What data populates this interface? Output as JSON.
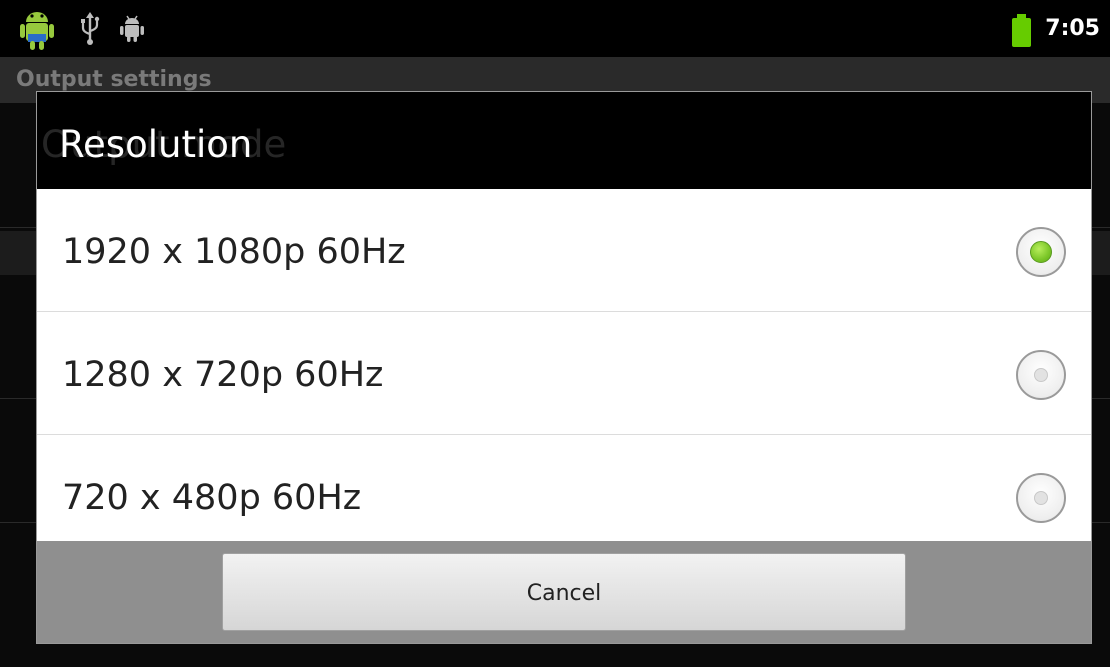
{
  "status_bar": {
    "time": "7:05",
    "left_icons": [
      "android-icon",
      "usb-icon",
      "debug-icon"
    ],
    "battery_color": "#66cc00"
  },
  "background_app": {
    "title": "Output settings",
    "obscured_item": "Output mode"
  },
  "dialog": {
    "title": "Resolution",
    "options": [
      {
        "label": "1920 x 1080p 60Hz",
        "selected": true
      },
      {
        "label": "1280 x 720p 60Hz",
        "selected": false
      },
      {
        "label": "720 x 480p 60Hz",
        "selected": false
      }
    ],
    "cancel_label": "Cancel",
    "accent_color": "#7bc628"
  }
}
